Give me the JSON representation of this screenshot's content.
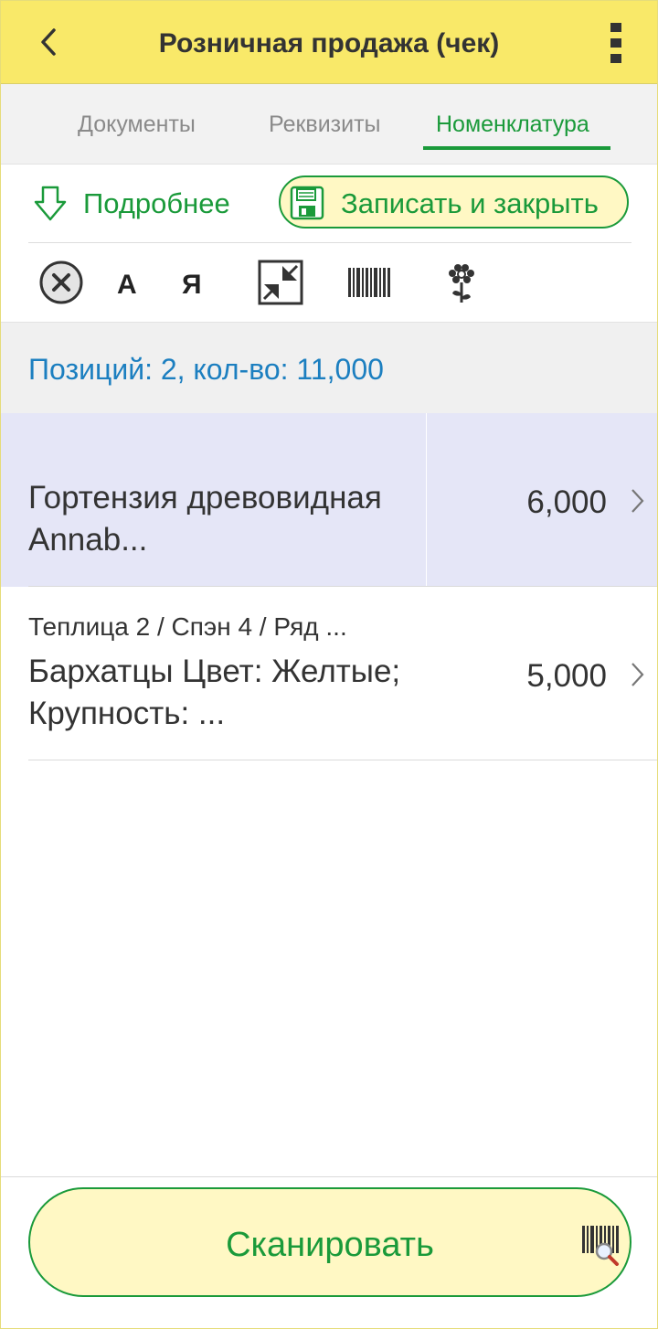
{
  "header": {
    "title": "Розничная продажа (чек)",
    "back_icon": "chevron-left-icon",
    "menu_icon": "more-vertical-icon"
  },
  "tabs": [
    {
      "label": "Документы",
      "active": false
    },
    {
      "label": "Реквизиты",
      "active": false
    },
    {
      "label": "Номенклатура",
      "active": true
    }
  ],
  "actions": {
    "more_label": "Подробнее",
    "save_label": "Записать и закрыть"
  },
  "toolbar": {
    "sort_asc_label": "А",
    "sort_desc_label": "Я"
  },
  "summary": {
    "text": "Позиций: 2, кол-во: 11,000"
  },
  "items": [
    {
      "location": "",
      "name": "Гортензия древовидная Annab...",
      "quantity": "6,000",
      "selected": true
    },
    {
      "location": "Теплица 2 / Спэн 4 / Ряд ...",
      "name": "Бархатцы Цвет: Желтые; Крупность: ...",
      "quantity": "5,000",
      "selected": false
    }
  ],
  "footer": {
    "scan_label": "Сканировать"
  },
  "colors": {
    "header_bg": "#f9e969",
    "accent_green": "#1a9a3a",
    "summary_blue": "#1c7fc0",
    "selected_row_bg": "#e5e6f7",
    "button_bg": "#fff8c4"
  }
}
